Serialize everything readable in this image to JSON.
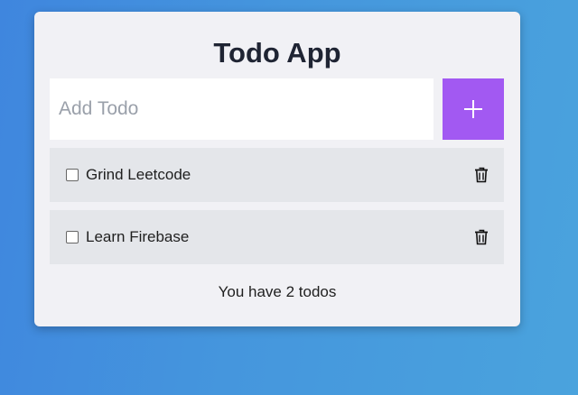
{
  "app": {
    "title": "Todo App"
  },
  "add_form": {
    "placeholder": "Add Todo",
    "value": "",
    "add_icon": "plus-icon"
  },
  "todos": [
    {
      "text": "Grind Leetcode",
      "completed": false,
      "delete_icon": "trash-icon"
    },
    {
      "text": "Learn Firebase",
      "completed": false,
      "delete_icon": "trash-icon"
    }
  ],
  "footer": {
    "count_text": "You have 2 todos"
  },
  "colors": {
    "accent": "#a259f2",
    "card_bg": "#f1f1f5",
    "item_bg": "#e4e6ea",
    "title": "#1f2433"
  }
}
